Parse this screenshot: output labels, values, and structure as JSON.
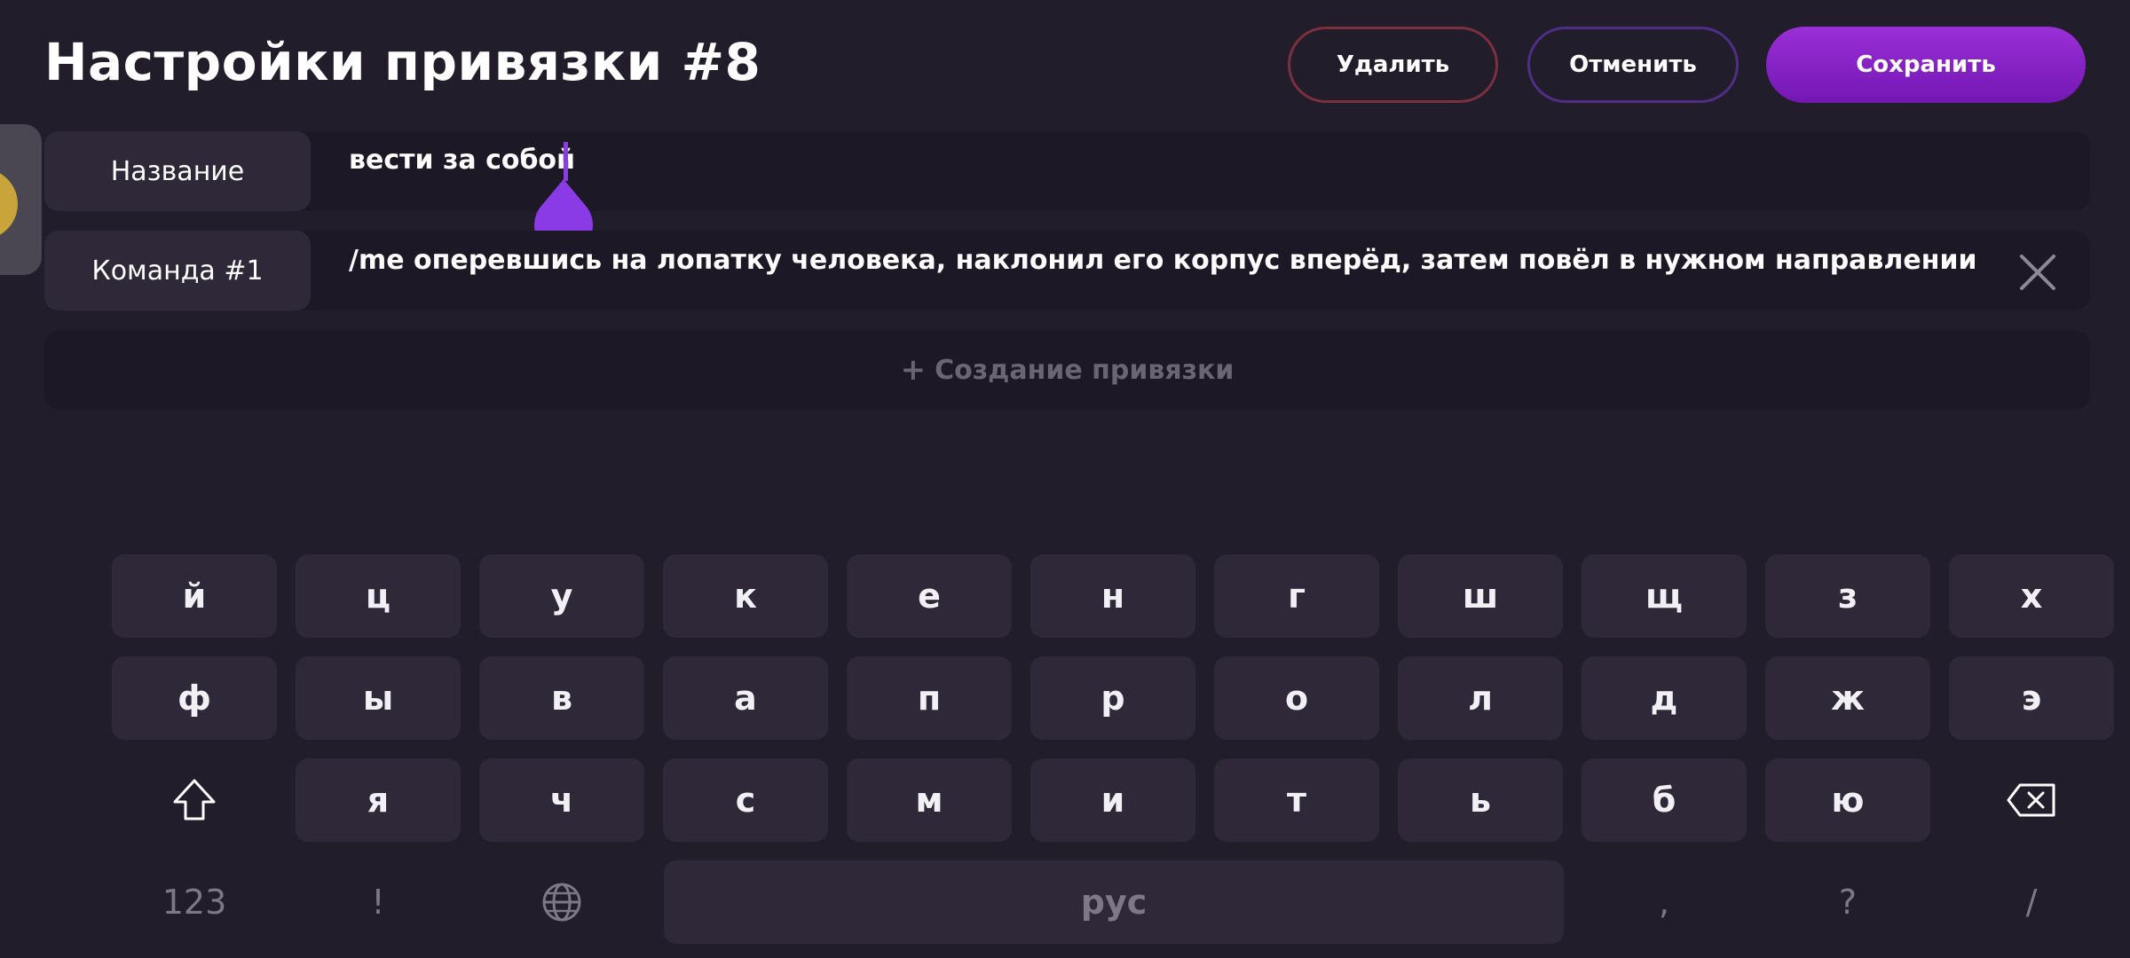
{
  "header": {
    "title": "Настройки привязки #8",
    "delete_label": "Удалить",
    "cancel_label": "Отменить",
    "save_label": "Сохранить"
  },
  "rows": {
    "name": {
      "label": "Название",
      "value": "вести за собой"
    },
    "command1": {
      "label": "Команда #1",
      "value": "/me оперевшись на лопатку человека, наклонил его корпус вперёд, затем повёл в нужном направлении"
    }
  },
  "create_binding_label": "Создание привязки",
  "keyboard": {
    "row1": [
      "й",
      "ц",
      "у",
      "к",
      "е",
      "н",
      "г",
      "ш",
      "щ",
      "з",
      "х"
    ],
    "row2": [
      "ф",
      "ы",
      "в",
      "а",
      "п",
      "р",
      "о",
      "л",
      "д",
      "ж",
      "э"
    ],
    "row3": [
      "я",
      "ч",
      "с",
      "м",
      "и",
      "т",
      "ь",
      "б",
      "ю"
    ],
    "row4": {
      "numbers": "123",
      "exclamation": "!",
      "space": "рус",
      "comma": ",",
      "question": "?",
      "slash": "/"
    }
  },
  "colors": {
    "background": "#221d2b",
    "accent": "#8a3be6",
    "save_button": "#7417b4"
  }
}
